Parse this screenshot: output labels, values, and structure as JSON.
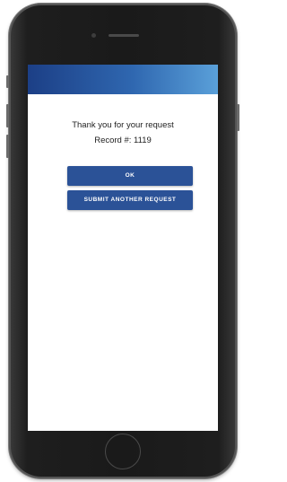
{
  "confirmation": {
    "thanks_text": "Thank you for your request",
    "record_text": "Record #: 1119"
  },
  "actions": {
    "ok_label": "OK",
    "submit_another_label": "SUBMIT ANOTHER REQUEST"
  },
  "colors": {
    "header_gradient_start": "#1c3f86",
    "header_gradient_end": "#5aa0d9",
    "button_bg": "#2b5297",
    "phone_frame": "#1a1a1a"
  },
  "icons": {
    "home_button": "home-button-icon",
    "camera": "camera-icon",
    "speaker": "speaker-icon"
  }
}
